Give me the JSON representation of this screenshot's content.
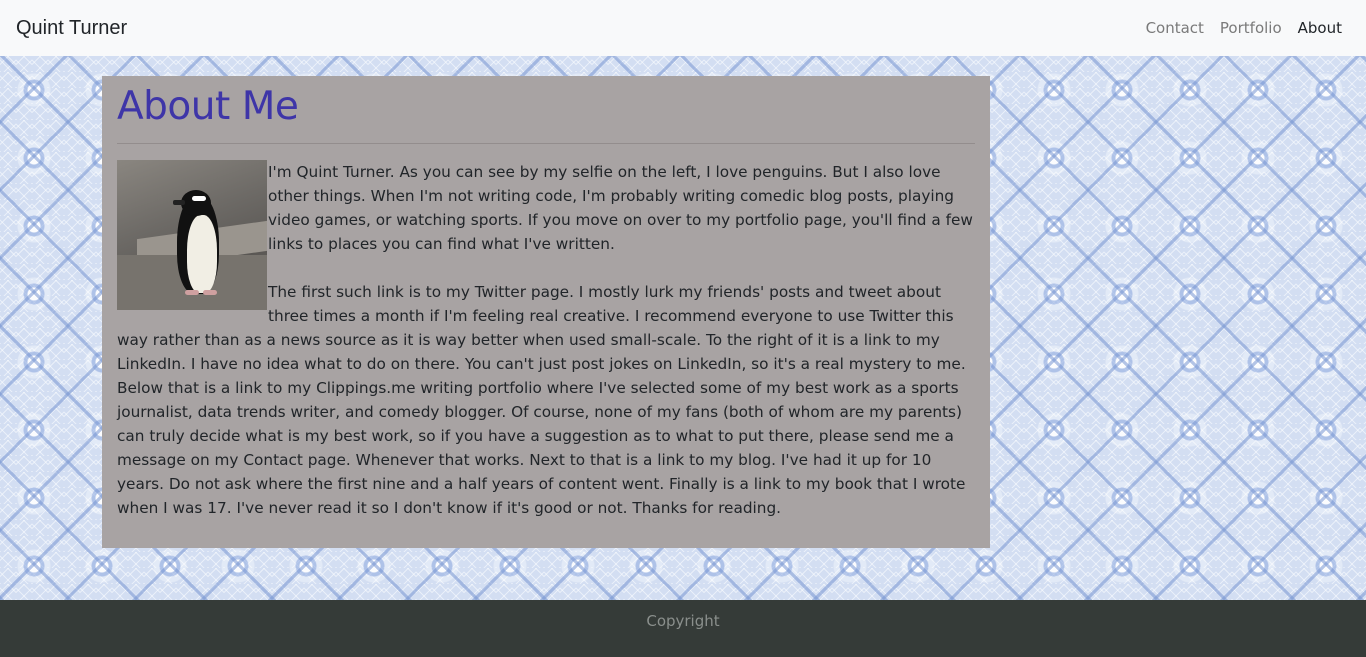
{
  "navbar": {
    "brand": "Quint Turner",
    "links": [
      {
        "label": "Contact",
        "active": false
      },
      {
        "label": "Portfolio",
        "active": false
      },
      {
        "label": "About",
        "active": true
      }
    ]
  },
  "main": {
    "title": "About Me",
    "image": {
      "icon": "penguin-photo"
    },
    "paragraph1": "I'm Quint Turner. As you can see by my selfie on the left, I love penguins. But I also love other things. When I'm not writing code, I'm probably writing comedic blog posts, playing video games, or watching sports. If you move on over to my portfolio page, you'll find a few links to places you can find what I've written.",
    "paragraph2": "The first such link is to my Twitter page. I mostly lurk my friends' posts and tweet about three times a month if I'm feeling real creative. I recommend everyone to use Twitter this way rather than as a news source as it is way better when used small-scale. To the right of it is a link to my LinkedIn. I have no idea what to do on there. You can't just post jokes on LinkedIn, so it's a real mystery to me. Below that is a link to my Clippings.me writing portfolio where I've selected some of my best work as a sports journalist, data trends writer, and comedy blogger. Of course, none of my fans (both of whom are my parents) can truly decide what is my best work, so if you have a suggestion as to what to put there, please send me a message on my Contact page. Whenever that works. Next to that is a link to my blog. I've had it up for 10 years. Do not ask where the first nine and a half years of content went. Finally is a link to my book that I wrote when I was 17. I've never read it so I don't know if it's good or not. Thanks for reading."
  },
  "footer": {
    "text": "Copyright"
  },
  "colors": {
    "title": "#3e35a8",
    "card": "#a8a3a3",
    "footer": "#353b38",
    "navbar": "#f8f9fa"
  }
}
